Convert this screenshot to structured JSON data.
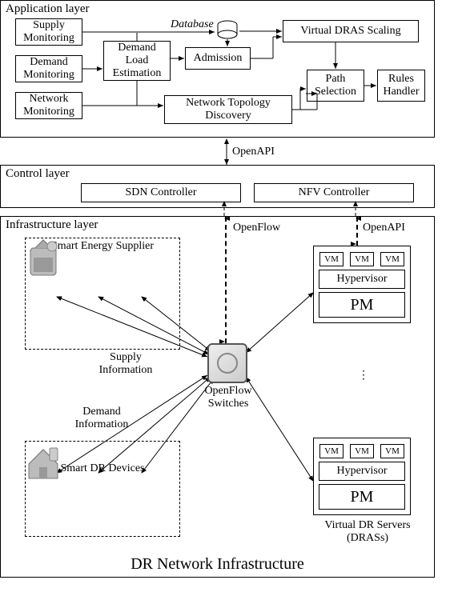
{
  "layers": {
    "application": {
      "title": "Application layer"
    },
    "control": {
      "title": "Control layer"
    },
    "infrastructure": {
      "title": "Infrastructure layer"
    }
  },
  "app": {
    "supplyMonitoring": "Supply Monitoring",
    "demandMonitoring": "Demand Monitoring",
    "networkMonitoring": "Network Monitoring",
    "demandLoadEstimation": "Demand Load Estimation",
    "database": "Database",
    "admission": "Admission",
    "virtualDrasScaling": "Virtual DRAS Scaling",
    "networkTopologyDiscovery": "Network Topology Discovery",
    "pathSelection": "Path Selection",
    "rulesHandler": "Rules Handler"
  },
  "control": {
    "sdn": "SDN Controller",
    "nfv": "NFV Controller"
  },
  "interfaces": {
    "openapi": "OpenAPI",
    "openflow": "OpenFlow"
  },
  "infra": {
    "smartEnergySupplier": "Smart Energy Supplier",
    "smartDrDevices": "Smart DR Devices",
    "supplyInformation": "Supply Information",
    "demandInformation": "Demand Information",
    "openflowSwitches": "OpenFlow Switches",
    "virtualDrServers": "Virtual DR Servers (DRASs)",
    "hypervisor": "Hypervisor",
    "pm": "PM",
    "vm": "VM",
    "title": "DR Network Infrastructure"
  }
}
